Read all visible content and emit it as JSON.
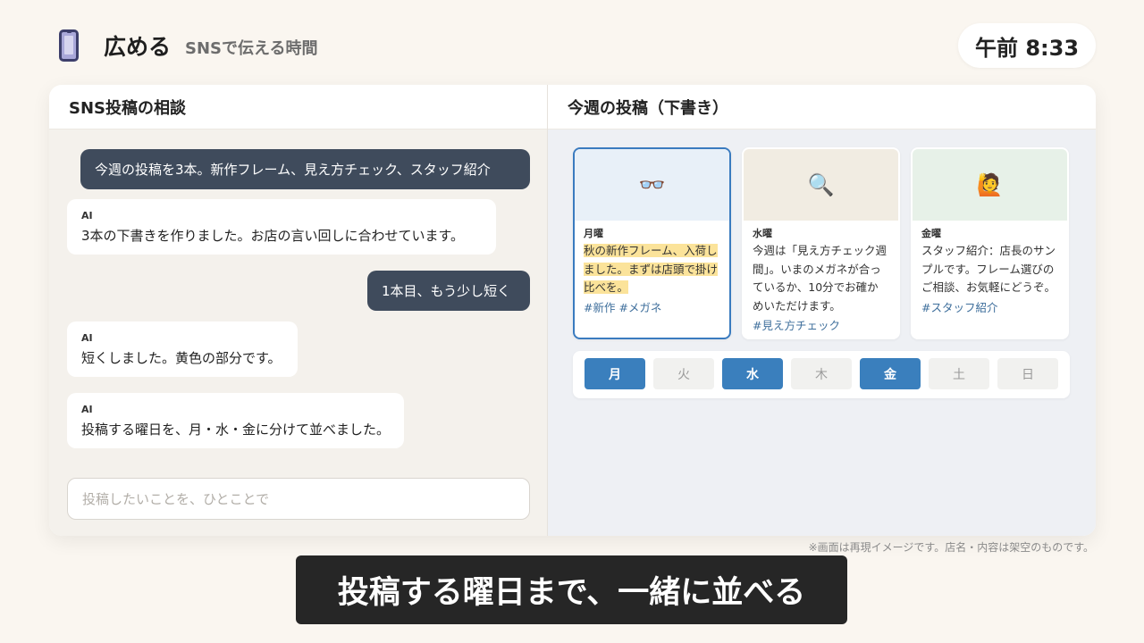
{
  "header": {
    "app_icon": "smartphone-icon",
    "title": "広める",
    "subtitle": "SNSで伝える時間",
    "clock": "午前 8:33"
  },
  "chat": {
    "title": "SNS投稿の相談",
    "messages": [
      {
        "role": "user",
        "text": "今週の投稿を3本。新作フレーム、見え方チェック、スタッフ紹介"
      },
      {
        "role": "ai",
        "label": "AI",
        "text": "3本の下書きを作りました。お店の言い回しに合わせています。"
      },
      {
        "role": "user",
        "text": "1本目、もう少し短く"
      },
      {
        "role": "ai",
        "label": "AI",
        "text": "短くしました。黄色の部分です。"
      },
      {
        "role": "ai",
        "label": "AI",
        "text": "投稿する曜日を、月・水・金に分けて並べました。"
      }
    ],
    "input_placeholder": "投稿したいことを、ひとことで"
  },
  "posts": {
    "title": "今週の投稿（下書き）",
    "cards": [
      {
        "icon": "eyeglasses-icon",
        "emoji": "👓",
        "image_bg": "#e8f0f8",
        "day": "月曜",
        "text_highlight": "秋の新作フレーム、入荷しました。まずは店頭で掛け比べを。",
        "text": "",
        "tags": "#新作 #メガネ",
        "selected": true
      },
      {
        "icon": "magnifier-icon",
        "emoji": "🔍",
        "image_bg": "#f1ece2",
        "day": "水曜",
        "text_highlight": "",
        "text": "今週は「見え方チェック週間」。いまのメガネが合っているか、10分でお確かめいただけます。",
        "tags": "#見え方チェック",
        "selected": false
      },
      {
        "icon": "staff-person-icon",
        "emoji": "🙋",
        "image_bg": "#e7f1e8",
        "day": "金曜",
        "text_highlight": "",
        "text": "スタッフ紹介：店長のサンプルです。フレーム選びのご相談、お気軽にどうぞ。",
        "tags": "#スタッフ紹介",
        "selected": false
      }
    ],
    "days": [
      {
        "label": "月",
        "active": true
      },
      {
        "label": "火",
        "active": false
      },
      {
        "label": "水",
        "active": true
      },
      {
        "label": "木",
        "active": false
      },
      {
        "label": "金",
        "active": true
      },
      {
        "label": "土",
        "active": false
      },
      {
        "label": "日",
        "active": false
      }
    ]
  },
  "disclaimer": "※画面は再現イメージです。店名・内容は架空のものです。",
  "caption": "投稿する曜日まで、一緒に並べる"
}
